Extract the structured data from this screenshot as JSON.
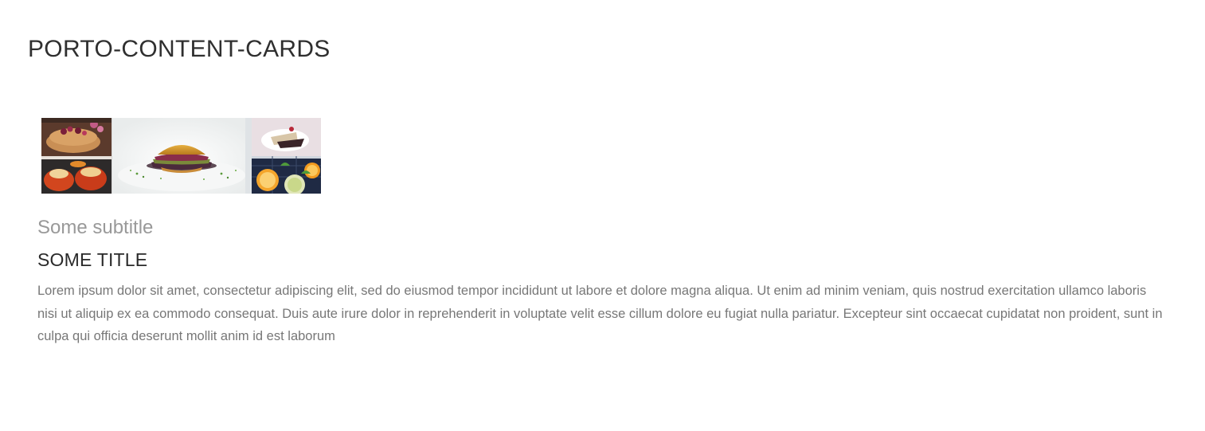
{
  "page": {
    "title": "PORTO-CONTENT-CARDS"
  },
  "card": {
    "image": {
      "description_icon": "food-collage-image"
    },
    "subtitle": "Some subtitle",
    "title": "SOME TITLE",
    "body": "Lorem ipsum dolor sit amet, consectetur adipiscing elit, sed do eiusmod tempor incididunt ut labore et dolore magna aliqua. Ut enim ad minim veniam, quis nostrud exercitation ullamco laboris nisi ut aliquip ex ea commodo consequat. Duis aute irure dolor in reprehenderit in voluptate velit esse cillum dolore eu fugiat nulla pariatur. Excepteur sint occaecat cupidatat non proident, sunt in culpa qui officia deserunt mollit anim id est laborum"
  },
  "colors": {
    "title": "#2f2f2f",
    "subtitle": "#999999",
    "body": "#777777",
    "background": "#ffffff"
  }
}
